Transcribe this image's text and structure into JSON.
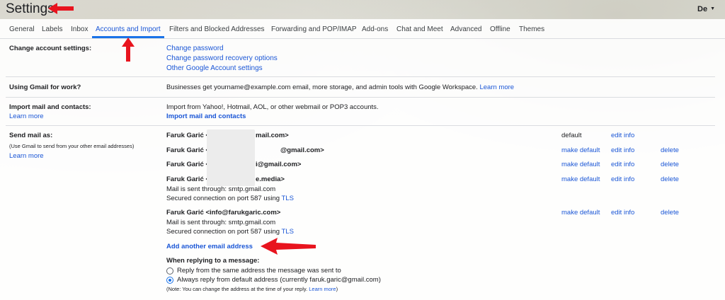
{
  "header": {
    "title": "Settings",
    "account_initials": "De"
  },
  "tabs": [
    {
      "label": "General"
    },
    {
      "label": "Labels"
    },
    {
      "label": "Inbox"
    },
    {
      "label": "Accounts and Import"
    },
    {
      "label": "Filters and Blocked Addresses"
    },
    {
      "label": "Forwarding and POP/IMAP"
    },
    {
      "label": "Add-ons"
    },
    {
      "label": "Chat and Meet"
    },
    {
      "label": "Advanced"
    },
    {
      "label": "Offline"
    },
    {
      "label": "Themes"
    }
  ],
  "change_account": {
    "label": "Change account settings:",
    "links": [
      "Change password",
      "Change password recovery options",
      "Other Google Account settings"
    ]
  },
  "gmail_work": {
    "label": "Using Gmail for work?",
    "text": "Businesses get yourname@example.com email, more storage, and admin tools with Google Workspace.",
    "learn_more": "Learn more"
  },
  "import_mail": {
    "label": "Import mail and contacts:",
    "learn_more": "Learn more",
    "text": "Import from Yahoo!, Hotmail, AOL, or other webmail or POP3 accounts.",
    "action": "Import mail and contacts"
  },
  "send_mail": {
    "label": "Send mail as:",
    "sub": "(Use Gmail to send from your other email addresses)",
    "learn_more": "Learn more",
    "addresses": [
      {
        "name": "Faruk Garić <",
        "tail": "mail.com>",
        "status": "default",
        "edit": "edit info"
      },
      {
        "name": "Faruk Garić <",
        "tail": "@gmail.com>",
        "make_default": "make default",
        "edit": "edit info",
        "delete": "delete"
      },
      {
        "name": "Faruk Garić <",
        "tail": "i@gmail.com>",
        "make_default": "make default",
        "edit": "edit info",
        "delete": "delete"
      },
      {
        "name": "Faruk Garić <",
        "tail": "e.media>",
        "make_default": "make default",
        "edit": "edit info",
        "delete": "delete",
        "sent_through": "Mail is sent through: smtp.gmail.com",
        "secured": "Secured connection on port 587 using",
        "tls": "TLS"
      },
      {
        "name": "Faruk Garić <info@farukgaric.com>",
        "make_default": "make default",
        "edit": "edit info",
        "delete": "delete",
        "sent_through": "Mail is sent through: smtp.gmail.com",
        "secured": "Secured connection on port 587 using",
        "tls": "TLS"
      }
    ],
    "add_another": "Add another email address",
    "reply_heading": "When replying to a message:",
    "reply_options": [
      "Reply from the same address the message was sent to",
      "Always reply from default address (currently faruk.garic@gmail.com)"
    ],
    "note": "(Note: You can change the address at the time of your reply.",
    "note_link": "Learn more",
    "note_end": ")"
  },
  "colors": {
    "link": "#1a56d6",
    "accent": "#1a73e8",
    "annotation": "#e8141e"
  }
}
